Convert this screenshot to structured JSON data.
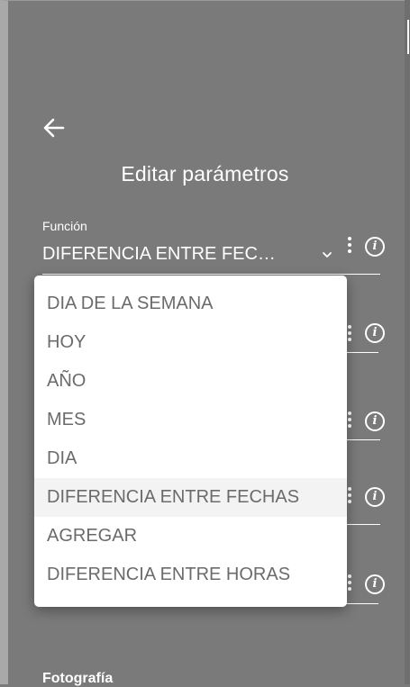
{
  "header": {
    "back_icon": "arrow-left-icon",
    "title": "Editar parámetros"
  },
  "form": {
    "funcion_label": "Función",
    "funcion_value": "DIFERENCIA ENTRE FEC…",
    "chevron_icon": "chevron-down-icon",
    "menu_icon": "vertical-dots-icon",
    "info_icon": "info-icon",
    "info_glyph": "i",
    "bottom_label": "Fotografía"
  },
  "dropdown": {
    "options": [
      {
        "label": "DIA DE LA SEMANA"
      },
      {
        "label": "HOY"
      },
      {
        "label": "AÑO"
      },
      {
        "label": "MES"
      },
      {
        "label": "DIA"
      },
      {
        "label": "DIFERENCIA ENTRE FECHAS",
        "selected": true
      },
      {
        "label": "AGREGAR"
      },
      {
        "label": "DIFERENCIA ENTRE HORAS"
      }
    ]
  },
  "colors": {
    "overlay": "#7a7a7a",
    "text_on_overlay": "#ffffff",
    "option_text": "#6b6b6b",
    "selected_bg": "#f3f3f3"
  }
}
